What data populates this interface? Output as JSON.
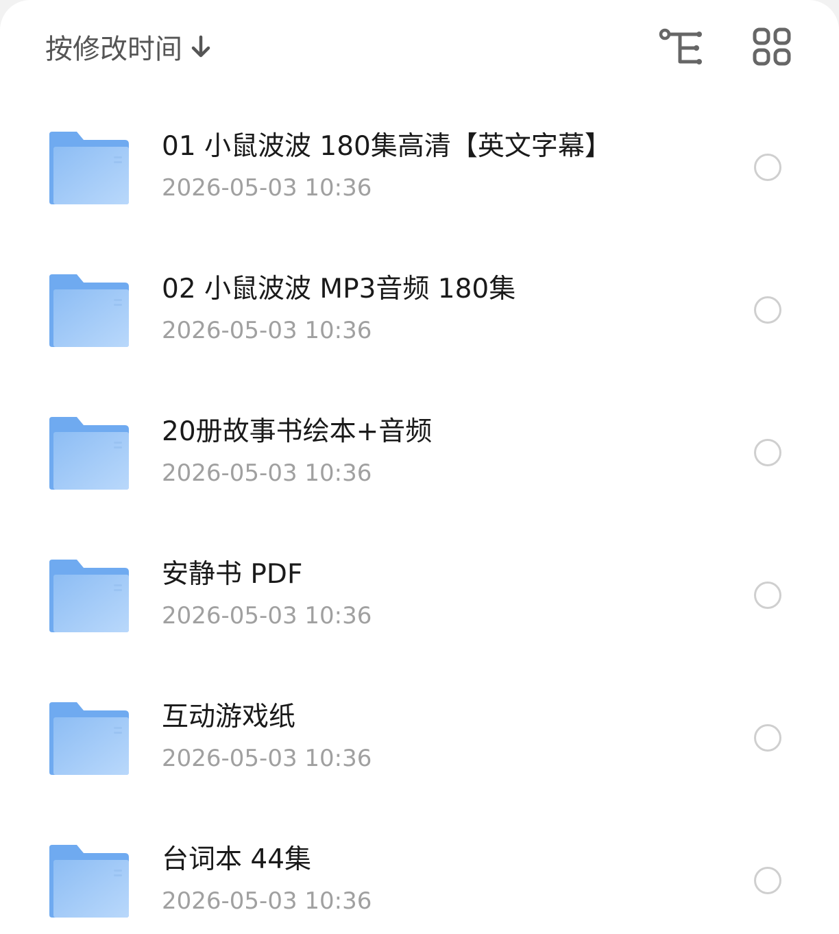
{
  "header": {
    "sort_label": "按修改时间",
    "sort_arrow_icon": "arrow-down-icon",
    "tree_view_icon": "tree-view-icon",
    "grid_view_icon": "grid-view-icon"
  },
  "colors": {
    "folder_top": "#6faaf0",
    "folder_body": "#9cc6f7",
    "text_primary": "#1a1a1a",
    "text_secondary": "#a0a0a0",
    "icon": "#666666"
  },
  "files": [
    {
      "name": "01 小鼠波波 180集高清【英文字幕】",
      "date": "2026-05-03 10:36",
      "icon": "folder-icon"
    },
    {
      "name": "02 小鼠波波 MP3音频 180集",
      "date": "2026-05-03 10:36",
      "icon": "folder-icon"
    },
    {
      "name": "20册故事书绘本+音频",
      "date": "2026-05-03 10:36",
      "icon": "folder-icon"
    },
    {
      "name": "安静书 PDF",
      "date": "2026-05-03 10:36",
      "icon": "folder-icon"
    },
    {
      "name": "互动游戏纸",
      "date": "2026-05-03 10:36",
      "icon": "folder-icon"
    },
    {
      "name": "台词本 44集",
      "date": "2026-05-03 10:36",
      "icon": "folder-icon"
    }
  ]
}
